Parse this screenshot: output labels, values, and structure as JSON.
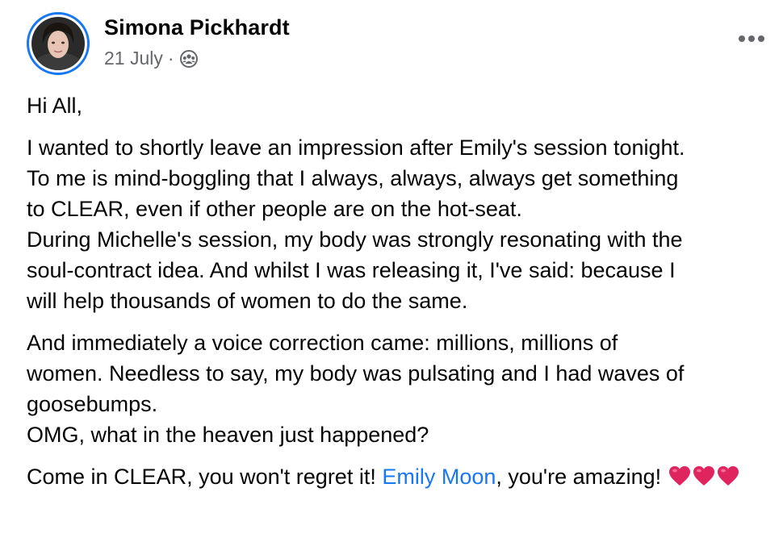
{
  "post": {
    "author": "Simona Pickhardt",
    "date": "21 July",
    "separator": "·",
    "audience_icon": "group-audience-icon",
    "more_icon": "more-options-icon",
    "paragraphs": [
      {
        "lines": [
          "Hi All,"
        ]
      },
      {
        "lines": [
          "I wanted to shortly leave an impression after Emily's session tonight.",
          "To me is mind-boggling that I always, always, always get something",
          "to CLEAR, even if other people are on the hot-seat.",
          "During Michelle's session, my body was strongly resonating with the",
          "soul-contract idea. And whilst I was releasing it, I've said: because I",
          "will help thousands of women to do the same."
        ]
      },
      {
        "lines": [
          "And immediately a voice correction came: millions, millions of",
          "women. Needless to say, my body was pulsating and I had waves of",
          "goosebumps.",
          "OMG, what in the heaven just happened?"
        ]
      }
    ],
    "closing": {
      "before_mention": "Come in CLEAR, you won't regret it! ",
      "mention": "Emily Moon",
      "after_mention": ", you're amazing! ",
      "emoji_icons": [
        "heart-emoji-icon",
        "heart-emoji-icon",
        "heart-emoji-icon"
      ]
    }
  },
  "colors": {
    "link": "#1877f2",
    "secondary_text": "#65676b",
    "primary_text": "#050505",
    "heart": "#e0245e"
  }
}
